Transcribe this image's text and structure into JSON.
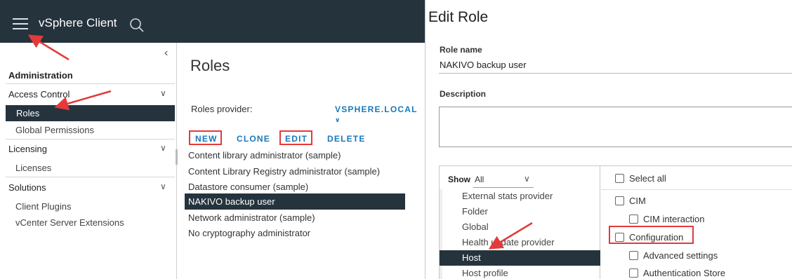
{
  "app": {
    "title": "vSphere Client"
  },
  "sidebar": {
    "section_title": "Administration",
    "groups": [
      {
        "label": "Access Control",
        "items": [
          "Roles",
          "Global Permissions"
        ]
      },
      {
        "label": "Licensing",
        "items": [
          "Licenses"
        ]
      },
      {
        "label": "Solutions",
        "items": [
          "Client Plugins",
          "vCenter Server Extensions"
        ]
      }
    ],
    "selected": "Roles"
  },
  "roles_page": {
    "title": "Roles",
    "provider_label": "Roles provider:",
    "provider_value": "VSPHERE.LOCAL",
    "actions": {
      "new": "NEW",
      "clone": "CLONE",
      "edit": "EDIT",
      "delete": "DELETE"
    },
    "roles": [
      "Content library administrator (sample)",
      "Content Library Registry administrator (sample)",
      "Datastore consumer (sample)",
      "NAKIVO backup user",
      "Network administrator (sample)",
      "No cryptography administrator"
    ],
    "selected_role": "NAKIVO backup user"
  },
  "edit_role": {
    "title": "Edit Role",
    "role_name_label": "Role name",
    "role_name_value": "NAKIVO backup user",
    "description_label": "Description",
    "description_value": "",
    "show_label": "Show",
    "show_value": "All",
    "categories": [
      "External stats provider",
      "Folder",
      "Global",
      "Health update provider",
      "Host",
      "Host profile"
    ],
    "selected_category": "Host",
    "privileges": {
      "select_all": "Select all",
      "cim": "CIM",
      "cim_interaction": "CIM interaction",
      "configuration": "Configuration",
      "advanced_settings": "Advanced settings",
      "authentication_store": "Authentication Store"
    }
  },
  "colors": {
    "header_bg": "#25333d",
    "accent": "#1779ba",
    "highlight": "#e43a3a"
  }
}
